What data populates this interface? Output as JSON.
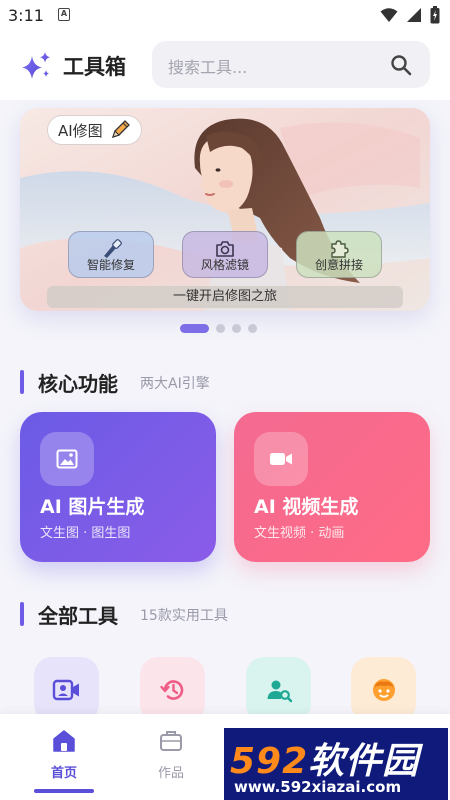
{
  "status_bar": {
    "time": "3:11",
    "notif_letter": "A"
  },
  "header": {
    "app_title": "工具箱",
    "search_placeholder": "搜索工具..."
  },
  "banner": {
    "tag_label": "AI修图",
    "features": [
      {
        "label": "智能修复",
        "icon": "brush-icon"
      },
      {
        "label": "风格滤镜",
        "icon": "camera-icon"
      },
      {
        "label": "创意拼接",
        "icon": "puzzle-icon"
      }
    ],
    "cta": "一键开启修图之旅",
    "page_count": 4,
    "active_page": 1
  },
  "core_section": {
    "title": "核心功能",
    "subtitle": "两大AI引擎",
    "cards": [
      {
        "title": "AI 图片生成",
        "subtitle": "文生图 · 图生图",
        "icon": "image-icon"
      },
      {
        "title": "AI 视频生成",
        "subtitle": "文生视频 · 动画",
        "icon": "video-camera-icon"
      }
    ]
  },
  "tools_section": {
    "title": "全部工具",
    "subtitle": "15款实用工具",
    "tools": [
      {
        "icon": "video-frame-icon"
      },
      {
        "icon": "history-icon"
      },
      {
        "icon": "user-search-icon"
      },
      {
        "icon": "face-icon"
      }
    ]
  },
  "tabbar": {
    "tabs": [
      {
        "label": "首页",
        "icon": "home-icon",
        "active": true
      },
      {
        "label": "作品",
        "icon": "briefcase-icon",
        "active": false
      }
    ]
  },
  "watermark": {
    "brand_digits": "592",
    "brand_text": "软件园",
    "url": "www.592xiazai.com"
  },
  "colors": {
    "accent": "#6e5ce6",
    "image_card": "#7a5ce8",
    "video_card": "#f76a8c",
    "tab_active": "#5b4ed9",
    "tab_inactive": "#9a9aa8"
  }
}
